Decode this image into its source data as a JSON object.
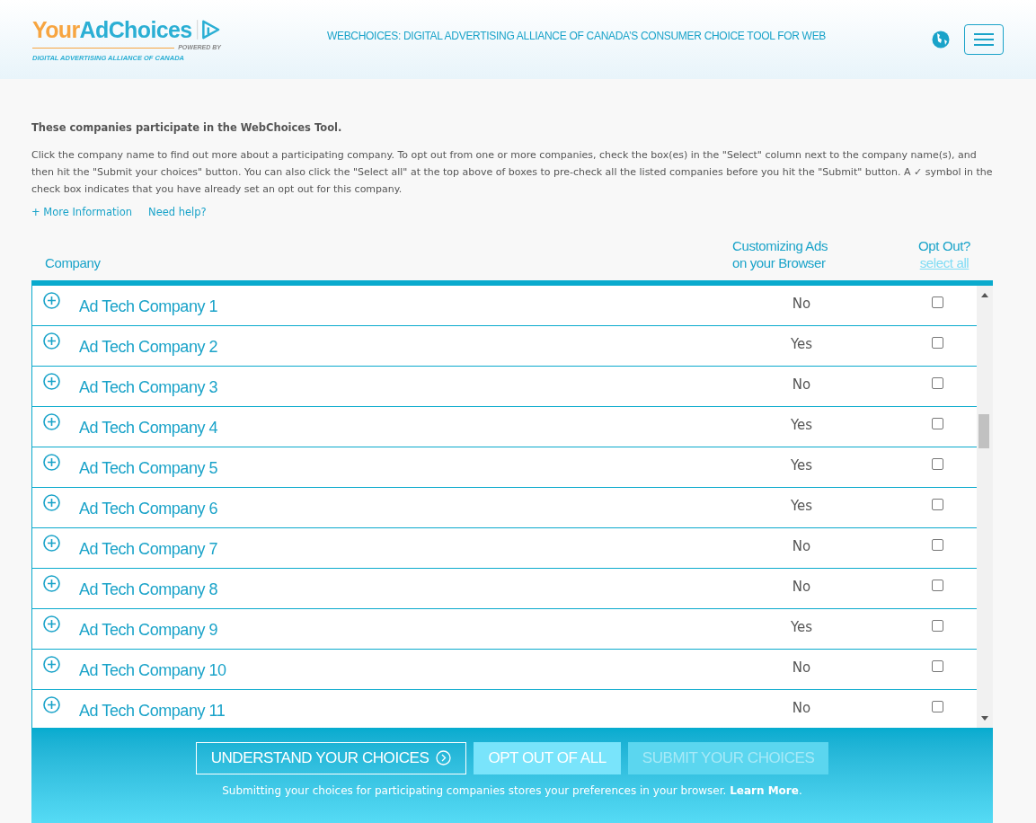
{
  "header": {
    "logo": {
      "part_1": "Your",
      "part_2": "AdChoices",
      "powered_by": "POWERED BY",
      "org": "DIGITAL ADVERTISING ALLIANCE OF CANADA"
    },
    "title": "WEBCHOICES: DIGITAL ADVERTISING ALLIANCE OF CANADA’S CONSUMER CHOICE TOOL FOR WEB"
  },
  "intro": {
    "heading": "These companies participate in the WebChoices Tool.",
    "body": "Click the company name to find out more about a participating company. To opt out from one or more companies, check the box(es) in the \"Select\" column next to the company name(s), and then hit the \"Submit your choices\" button. You can also click the \"Select all\" at the top above of boxes to pre-check all the listed companies before you hit the \"Submit\" button. A ✓ symbol in the check box indicates that you have already set an opt out for this company.",
    "links": [
      "+ More Information",
      "Need help?"
    ]
  },
  "table": {
    "columns": [
      "Company",
      "Customizing Ads\non your Browser",
      "Opt Out?"
    ],
    "select_all": "select all",
    "rows": [
      {
        "company": "Ad Tech Company 1",
        "customizing": "No",
        "checked": false
      },
      {
        "company": "Ad Tech Company 2",
        "customizing": "Yes",
        "checked": false
      },
      {
        "company": "Ad Tech Company 3",
        "customizing": "No",
        "checked": false
      },
      {
        "company": "Ad Tech Company 4",
        "customizing": "Yes",
        "checked": false
      },
      {
        "company": "Ad Tech Company 5",
        "customizing": "Yes",
        "checked": false
      },
      {
        "company": "Ad Tech Company 6",
        "customizing": "Yes",
        "checked": false
      },
      {
        "company": "Ad Tech Company 7",
        "customizing": "No",
        "checked": false
      },
      {
        "company": "Ad Tech Company 8",
        "customizing": "No",
        "checked": false
      },
      {
        "company": "Ad Tech Company 9",
        "customizing": "Yes",
        "checked": false
      },
      {
        "company": "Ad Tech Company 10",
        "customizing": "No",
        "checked": false
      },
      {
        "company": "Ad Tech Company 11",
        "customizing": "No",
        "checked": false
      }
    ]
  },
  "footer": {
    "buttons": [
      {
        "label": "UNDERSTAND YOUR CHOICES",
        "kind": "outline",
        "disabled": false
      },
      {
        "label": "OPT OUT OF ALL",
        "kind": "solid",
        "disabled": false
      },
      {
        "label": "SUBMIT YOUR CHOICES",
        "kind": "solid",
        "disabled": true
      }
    ],
    "note": "Submitting your choices for participating companies stores your preferences in your browser. **Learn More**."
  }
}
